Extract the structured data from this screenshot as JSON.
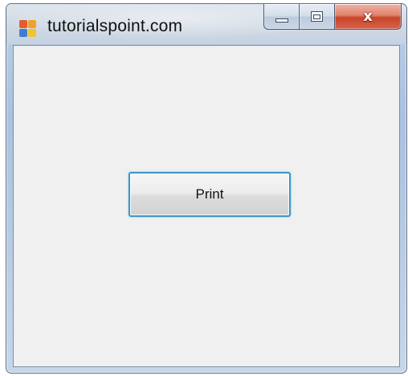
{
  "window": {
    "title": "tutorialspoint.com",
    "icon": "windows-form-icon"
  },
  "caption_buttons": {
    "minimize_icon": "minimize-icon",
    "maximize_icon": "maximize-icon",
    "close_label": "x",
    "close_icon": "close-icon"
  },
  "form": {
    "print_button_label": "Print"
  },
  "colors": {
    "client_background": "#f0f0f0",
    "button_focus_border": "#3c97c8",
    "close_button": "#c8442a"
  }
}
